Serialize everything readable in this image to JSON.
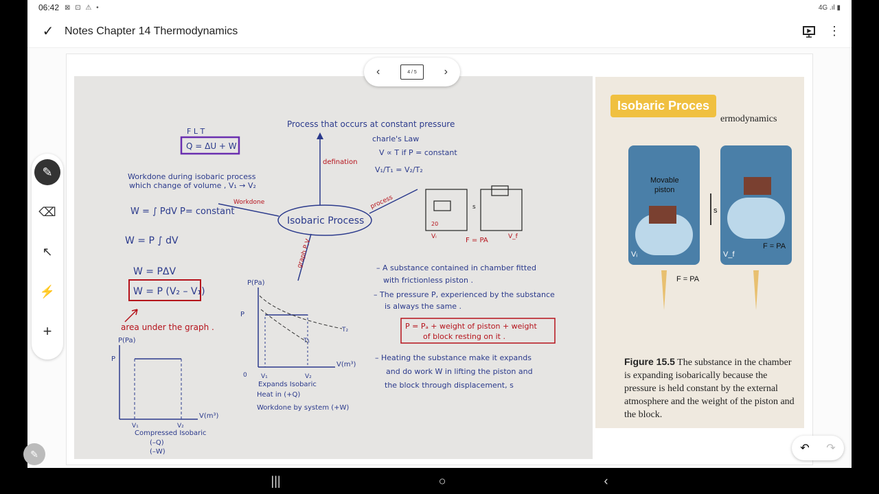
{
  "status": {
    "time": "06:42",
    "icons": "⊠ ⊡ ⚠ •",
    "right": "4G .ıl ▮"
  },
  "appbar": {
    "title": "Notes Chapter 14 Thermodynamics"
  },
  "pager": {
    "page_label": "4 / 5"
  },
  "notes": {
    "flt_label": "F L T",
    "flt_eq": "Q = ΔU + W",
    "work_desc_1": "Workdone during isobaric process",
    "work_desc_2": "which change of volume , V₁ → V₂",
    "w_integral": "W = ∫ PdV   P= constant",
    "w_integral2": "W = P ∫ dV",
    "w_pdv": "W = PΔV",
    "w_boxed": "W = P (V₂ – V₁)",
    "area_note": "area under the graph .",
    "definition_title": "Process that occurs at constant pressure",
    "definition_arrow": "defination",
    "charles_title": "charle's Law",
    "charles_rel": "V ∝ T  if  P = constant",
    "charles_ratio": "V₁/T₁ = V₂/T₂",
    "center_label": "Isobaric Process",
    "workdone_arrow": "Workdone",
    "process_arrow": "process",
    "graph_arrow": "graph P,V",
    "bullet1_a": "– A substance contained in chamber fitted",
    "bullet1_b": "with frictionless piston .",
    "bullet2_a": "– The pressure P, experienced by the substance",
    "bullet2_b": "is always the same .",
    "pressure_box_a": "P = Pₐ  + weight of piston + weight",
    "pressure_box_b": "of block resting on it .",
    "bullet3_a": "– Heating the substance make it expands",
    "bullet3_b": "and do work W in lifting the piston and",
    "bullet3_c": "the block through displacement, s",
    "graph1_ylabel": "P(Pa)",
    "graph1_p": "P",
    "graph1_xlabel": "V(m³)",
    "graph1_v1": "V₁",
    "graph1_v2": "V₂",
    "graph1_caption_1": "Compressed Isobaric",
    "graph1_caption_2": "(–Q)",
    "graph1_caption_3": "(–W)",
    "graph2_ylabel": "P(Pa)",
    "graph2_p": "P",
    "graph2_xlabel": "V(m³)",
    "graph2_origin": "0",
    "graph2_v1": "V₁",
    "graph2_v2": "V₂",
    "graph2_t1": "T₁",
    "graph2_t2": "T₂",
    "graph2_caption_1": "Expands Isobaric",
    "graph2_caption_2": "Heat in (+Q)",
    "graph2_caption_3": "Workdone by system (+W)",
    "sketch_fpa": "F = PA",
    "sketch_s": "s",
    "sketch_vi": "Vᵢ",
    "sketch_vf": "V_f",
    "sketch_20": "20"
  },
  "photo": {
    "label": "Isobaric Proces",
    "chapter": "ermodynamics",
    "movable": "Movable",
    "piston": "piston",
    "vi": "Vᵢ",
    "vf": "V_f",
    "s": "s",
    "fpa_left": "F = PA",
    "fpa_right": "F = PA",
    "caption_bold": "Figure 15.5",
    "caption_text": " The substance in the chamber is expanding isobarically because the pressure is held constant by the external atmosphere and the weight of the piston and the block."
  },
  "colors": {
    "ink_blue": "#2b3a8c",
    "ink_red": "#b5121b",
    "ink_purple": "#6a2fb0",
    "label_yellow": "#f0c040"
  }
}
